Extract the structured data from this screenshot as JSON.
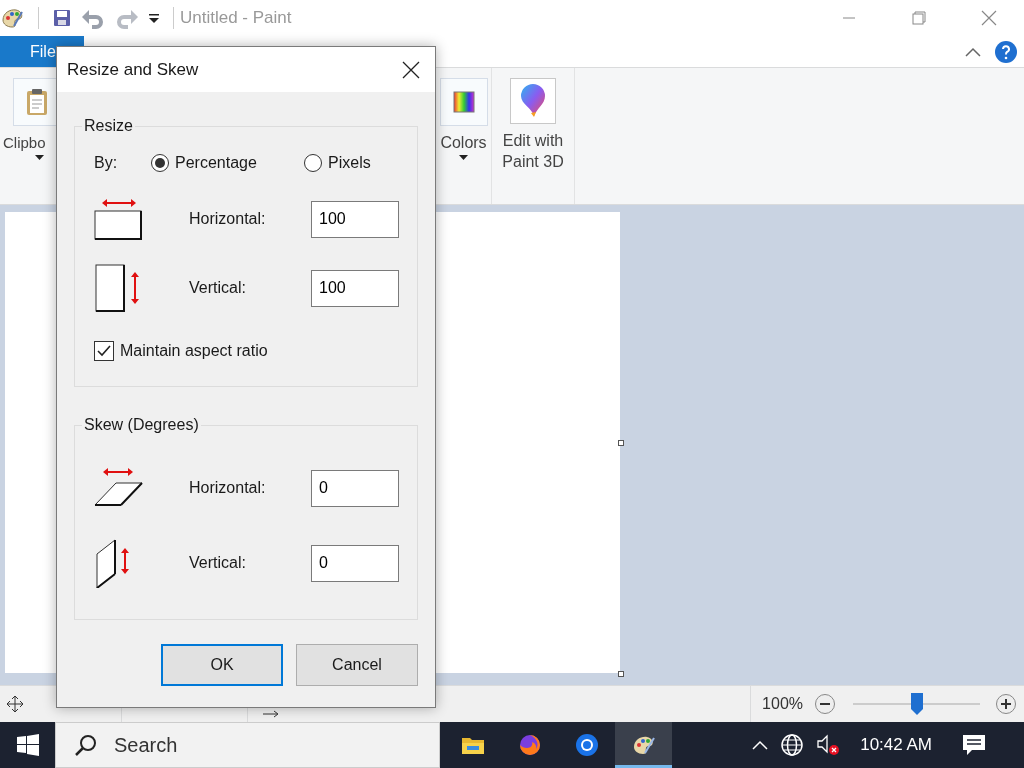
{
  "window": {
    "title": "Untitled - Paint"
  },
  "ribbon": {
    "file_tab": "File",
    "groups": [
      {
        "label": "Clipbo",
        "kind": "clipboard"
      },
      {
        "label": "Colors",
        "kind": "colors"
      },
      {
        "label": "Edit with Paint 3D",
        "kind": "paint3d"
      }
    ]
  },
  "status_bar": {
    "zoom": "100%",
    "zoom_slider": {
      "level": 0.5
    }
  },
  "dialog": {
    "title": "Resize and Skew",
    "resize": {
      "legend": "Resize",
      "by_label": "By:",
      "options": [
        {
          "label": "Percentage",
          "selected": true
        },
        {
          "label": "Pixels",
          "selected": false
        }
      ],
      "fields": [
        {
          "kind": "width",
          "label": "Horizontal:",
          "value": "100"
        },
        {
          "kind": "height",
          "label": "Vertical:",
          "value": "100"
        }
      ],
      "maintain_ratio": {
        "label": "Maintain aspect ratio",
        "checked": true
      }
    },
    "skew": {
      "legend": "Skew (Degrees)",
      "fields": [
        {
          "kind": "skew-h",
          "label": "Horizontal:",
          "value": "0"
        },
        {
          "kind": "skew-v",
          "label": "Vertical:",
          "value": "0"
        }
      ]
    },
    "buttons": [
      {
        "label": "OK",
        "default": true
      },
      {
        "label": "Cancel",
        "default": false
      }
    ]
  },
  "taskbar": {
    "search_placeholder": "Search",
    "apps": [
      {
        "kind": "folder",
        "active": false
      },
      {
        "kind": "firefox",
        "active": false
      },
      {
        "kind": "chrome",
        "active": false
      },
      {
        "kind": "paint",
        "active": true
      }
    ],
    "clock": "10:42 AM"
  }
}
